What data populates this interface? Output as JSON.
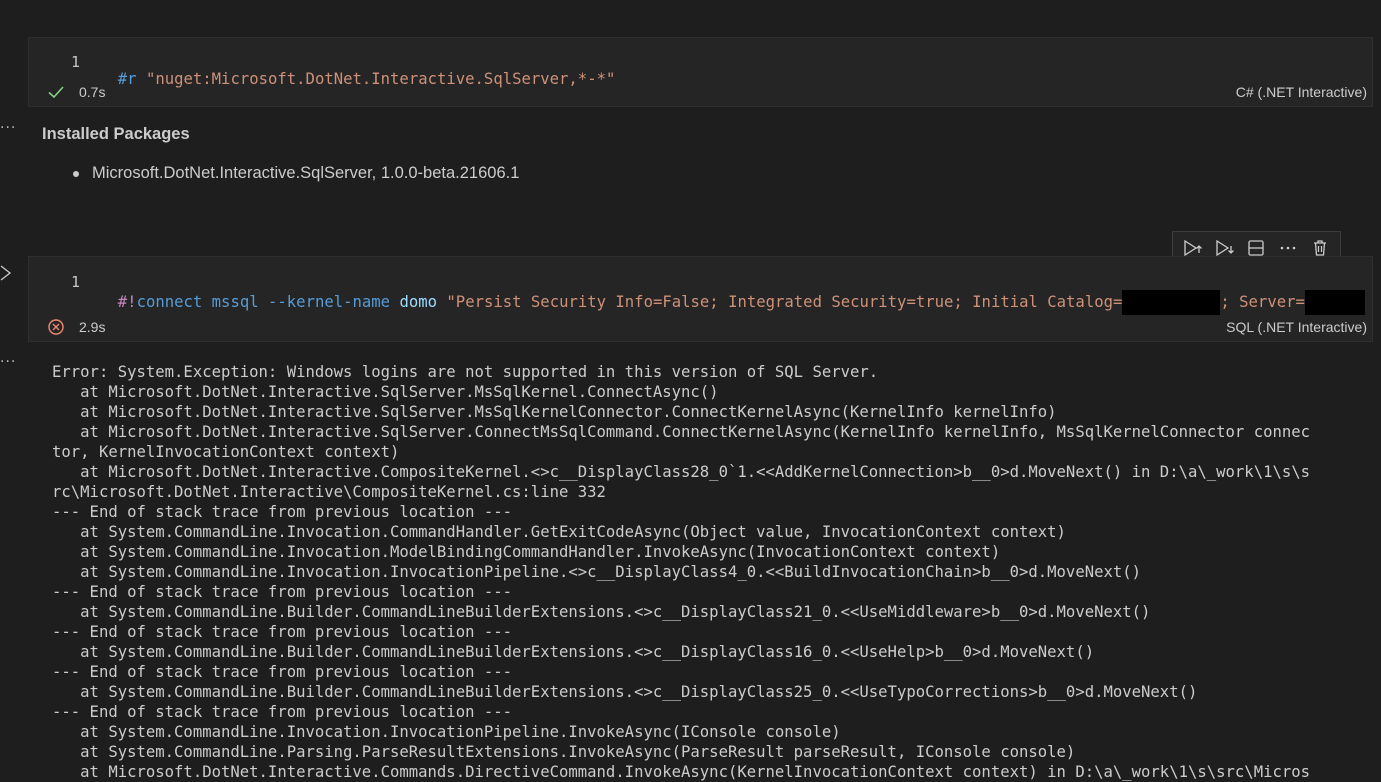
{
  "cell1": {
    "line_number": "1",
    "code": {
      "directive": "#r",
      "string": "\"nuget:Microsoft.DotNet.Interactive.SqlServer,*-*\""
    },
    "status": "success",
    "status_icon": "check-icon",
    "time": "0.7s",
    "kernel": "C# (.NET Interactive)"
  },
  "output1": {
    "heading": "Installed Packages",
    "packages": [
      "Microsoft.DotNet.Interactive.SqlServer, 1.0.0-beta.21606.1"
    ]
  },
  "toolbar": {
    "buttons": [
      {
        "name": "execute-above-icon"
      },
      {
        "name": "execute-below-icon"
      },
      {
        "name": "split-cell-icon"
      },
      {
        "name": "more-actions-icon"
      },
      {
        "name": "delete-icon"
      }
    ]
  },
  "cell2": {
    "line_number": "1",
    "code": {
      "bang": "#!",
      "command": "connect",
      "arg1": "mssql",
      "option": "--kernel-name",
      "kernel_name": "domo",
      "connection_string_a": "\"Persist Security Info=False; Integrated Security=true; Initial Catalog=",
      "connection_string_b": "; Server="
    },
    "status": "error",
    "status_icon": "error-circle-icon",
    "time": "2.9s",
    "kernel": "SQL (.NET Interactive)"
  },
  "error_output": {
    "lines": [
      "Error: System.Exception: Windows logins are not supported in this version of SQL Server.",
      "   at Microsoft.DotNet.Interactive.SqlServer.MsSqlKernel.ConnectAsync()",
      "   at Microsoft.DotNet.Interactive.SqlServer.MsSqlKernelConnector.ConnectKernelAsync(KernelInfo kernelInfo)",
      "   at Microsoft.DotNet.Interactive.SqlServer.ConnectMsSqlCommand.ConnectKernelAsync(KernelInfo kernelInfo, MsSqlKernelConnector connec",
      "tor, KernelInvocationContext context)",
      "   at Microsoft.DotNet.Interactive.CompositeKernel.<>c__DisplayClass28_0`1.<<AddKernelConnection>b__0>d.MoveNext() in D:\\a\\_work\\1\\s\\s",
      "rc\\Microsoft.DotNet.Interactive\\CompositeKernel.cs:line 332",
      "--- End of stack trace from previous location ---",
      "   at System.CommandLine.Invocation.CommandHandler.GetExitCodeAsync(Object value, InvocationContext context)",
      "   at System.CommandLine.Invocation.ModelBindingCommandHandler.InvokeAsync(InvocationContext context)",
      "   at System.CommandLine.Invocation.InvocationPipeline.<>c__DisplayClass4_0.<<BuildInvocationChain>b__0>d.MoveNext()",
      "--- End of stack trace from previous location ---",
      "   at System.CommandLine.Builder.CommandLineBuilderExtensions.<>c__DisplayClass21_0.<<UseMiddleware>b__0>d.MoveNext()",
      "--- End of stack trace from previous location ---",
      "   at System.CommandLine.Builder.CommandLineBuilderExtensions.<>c__DisplayClass16_0.<<UseHelp>b__0>d.MoveNext()",
      "--- End of stack trace from previous location ---",
      "   at System.CommandLine.Builder.CommandLineBuilderExtensions.<>c__DisplayClass25_0.<<UseTypoCorrections>b__0>d.MoveNext()",
      "--- End of stack trace from previous location ---",
      "   at System.CommandLine.Invocation.InvocationPipeline.InvokeAsync(IConsole console)",
      "   at System.CommandLine.Parsing.ParseResultExtensions.InvokeAsync(ParseResult parseResult, IConsole console)",
      "   at Microsoft.DotNet.Interactive.Commands.DirectiveCommand.InvokeAsync(KernelInvocationContext context) in D:\\a\\_work\\1\\s\\src\\Micros"
    ]
  },
  "colors": {
    "background": "#1e1e1e",
    "cell_background": "#252526",
    "success": "#89d185",
    "error": "#f48771",
    "keyword": "#569cd6",
    "string": "#ce9178"
  }
}
